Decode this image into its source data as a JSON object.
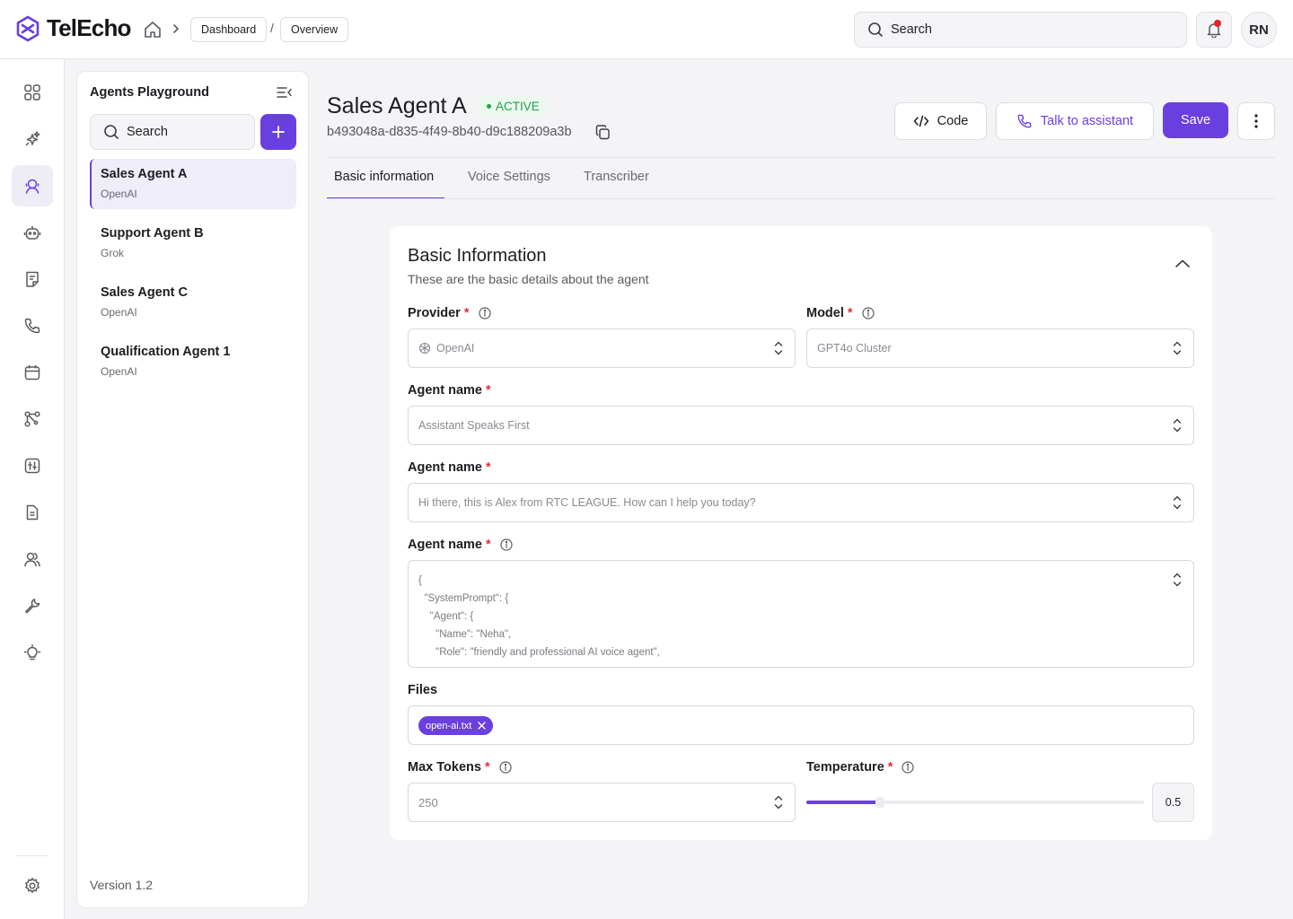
{
  "app": {
    "name": "TelEcho"
  },
  "breadcrumb": {
    "items": [
      "Dashboard",
      "Overview"
    ],
    "separator": "/"
  },
  "topbar": {
    "search_placeholder": "Search",
    "user_initials": "RN"
  },
  "rail": {
    "icons": [
      "grid-icon",
      "sparkles-icon",
      "agent-icon",
      "robot-icon",
      "document-icon",
      "phone-icon",
      "calendar-icon",
      "workflow-icon",
      "sliders-icon",
      "file-icon",
      "users-icon",
      "wrench-icon",
      "lightbulb-icon",
      "settings-icon"
    ],
    "active": "agent-icon"
  },
  "panel": {
    "title": "Agents Playground",
    "search_placeholder": "Search",
    "agents": [
      {
        "name": "Sales Agent A",
        "provider": "OpenAI",
        "active": true
      },
      {
        "name": "Support Agent B",
        "provider": "Grok",
        "active": false
      },
      {
        "name": "Sales Agent C",
        "provider": "OpenAI",
        "active": false
      },
      {
        "name": "Qualification Agent 1",
        "provider": "OpenAI",
        "active": false
      }
    ],
    "version": "Version 1.2"
  },
  "agent": {
    "title": "Sales Agent A",
    "status": "ACTIVE",
    "id": "b493048a-d835-4f49-8b40-d9c188209a3b"
  },
  "actions": {
    "code": "Code",
    "talk": "Talk to assistant",
    "save": "Save"
  },
  "tabs": [
    "Basic information",
    "Voice Settings",
    "Transcriber"
  ],
  "active_tab": "Basic information",
  "card": {
    "title": "Basic Information",
    "subtitle": "These are the basic details about the agent",
    "provider": {
      "label": "Provider",
      "value": "OpenAI"
    },
    "model": {
      "label": "Model",
      "value": "GPT4o Cluster"
    },
    "first_message_mode": {
      "label": "Agent name",
      "value": "Assistant Speaks First"
    },
    "first_message": {
      "label": "Agent name",
      "value": "Hi there, this is Alex from RTC LEAGUE. How can I help you today?"
    },
    "system_prompt": {
      "label": "Agent name",
      "lines": [
        "{",
        "  \"SystemPrompt\": {",
        "    \"Agent\": {",
        "      \"Name\": \"Neha\",",
        "      \"Role\": \"friendly and professional AI voice agent\","
      ]
    },
    "files": {
      "label": "Files",
      "items": [
        "open-ai.txt"
      ]
    },
    "max_tokens": {
      "label": "Max Tokens",
      "value": "250"
    },
    "temperature": {
      "label": "Temperature",
      "value": "0.5",
      "fraction": 0.21
    }
  },
  "colors": {
    "accent": "#6a3fe0",
    "active_green": "#22a04b",
    "required": "#e0303a"
  }
}
